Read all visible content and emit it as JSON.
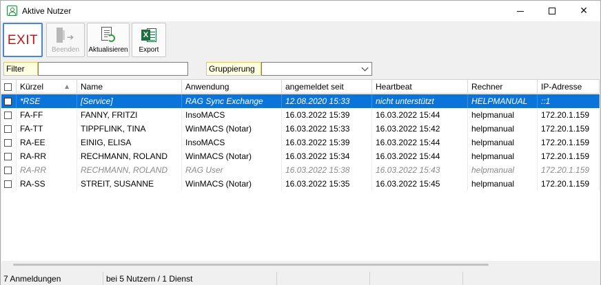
{
  "window": {
    "title": "Aktive Nutzer",
    "close_glyph": "✕"
  },
  "toolbar": {
    "exit_label": "EXIT",
    "beenden_label": "Beenden",
    "aktualisieren_label": "Aktualisieren",
    "export_label": "Export",
    "excel_glyph": "X"
  },
  "filter": {
    "label": "Filter",
    "value": "",
    "group_label": "Gruppierung",
    "group_value": ""
  },
  "grid": {
    "columns": [
      "Kürzel",
      "Name",
      "Anwendung",
      "angemeldet seit",
      "Heartbeat",
      "Rechner",
      "IP-Adresse"
    ],
    "sort_indicator": "▲",
    "rows": [
      {
        "kuerzel": "*RSE",
        "name": "[Service]",
        "anwendung": "RAG Sync Exchange",
        "seit": "12.08.2020 15:33",
        "heartbeat": "nicht unterstützt",
        "rechner": "HELPMANUAL",
        "ip": "::1",
        "state": "selected"
      },
      {
        "kuerzel": "FA-FF",
        "name": "FANNY, FRITZI",
        "anwendung": "InsoMACS",
        "seit": "16.03.2022 15:39",
        "heartbeat": "16.03.2022 15:44",
        "rechner": "helpmanual",
        "ip": "172.20.1.159",
        "state": "normal"
      },
      {
        "kuerzel": "FA-TT",
        "name": "TIPPFLINK, TINA",
        "anwendung": "WinMACS (Notar)",
        "seit": "16.03.2022 15:33",
        "heartbeat": "16.03.2022 15:42",
        "rechner": "helpmanual",
        "ip": "172.20.1.159",
        "state": "normal"
      },
      {
        "kuerzel": "RA-EE",
        "name": "EINIG, ELISA",
        "anwendung": "InsoMACS",
        "seit": "16.03.2022 15:39",
        "heartbeat": "16.03.2022 15:44",
        "rechner": "helpmanual",
        "ip": "172.20.1.159",
        "state": "normal"
      },
      {
        "kuerzel": "RA-RR",
        "name": "RECHMANN, ROLAND",
        "anwendung": "WinMACS (Notar)",
        "seit": "16.03.2022 15:34",
        "heartbeat": "16.03.2022 15:44",
        "rechner": "helpmanual",
        "ip": "172.20.1.159",
        "state": "normal"
      },
      {
        "kuerzel": "RA-RR",
        "name": "RECHMANN, ROLAND",
        "anwendung": "RAG User",
        "seit": "16.03.2022 15:38",
        "heartbeat": "16.03.2022 15:43",
        "rechner": "helpmanual",
        "ip": "172.20.1.159",
        "state": "inactive"
      },
      {
        "kuerzel": "RA-SS",
        "name": "STREIT, SUSANNE",
        "anwendung": "WinMACS (Notar)",
        "seit": "16.03.2022 15:35",
        "heartbeat": "16.03.2022 15:45",
        "rechner": "helpmanual",
        "ip": "172.20.1.159",
        "state": "normal"
      }
    ]
  },
  "status": {
    "anmeldungen": "7  Anmeldungen",
    "summary": "bei 5 Nutzern / 1 Dienst"
  },
  "icons": {
    "app": "user-icon",
    "beenden": "door-exit-icon",
    "aktualisieren": "refresh-document-icon",
    "export": "excel-icon"
  },
  "colors": {
    "selection": "#0a74d9",
    "exit_text": "#d01010",
    "label_bg": "#ffffe1"
  }
}
